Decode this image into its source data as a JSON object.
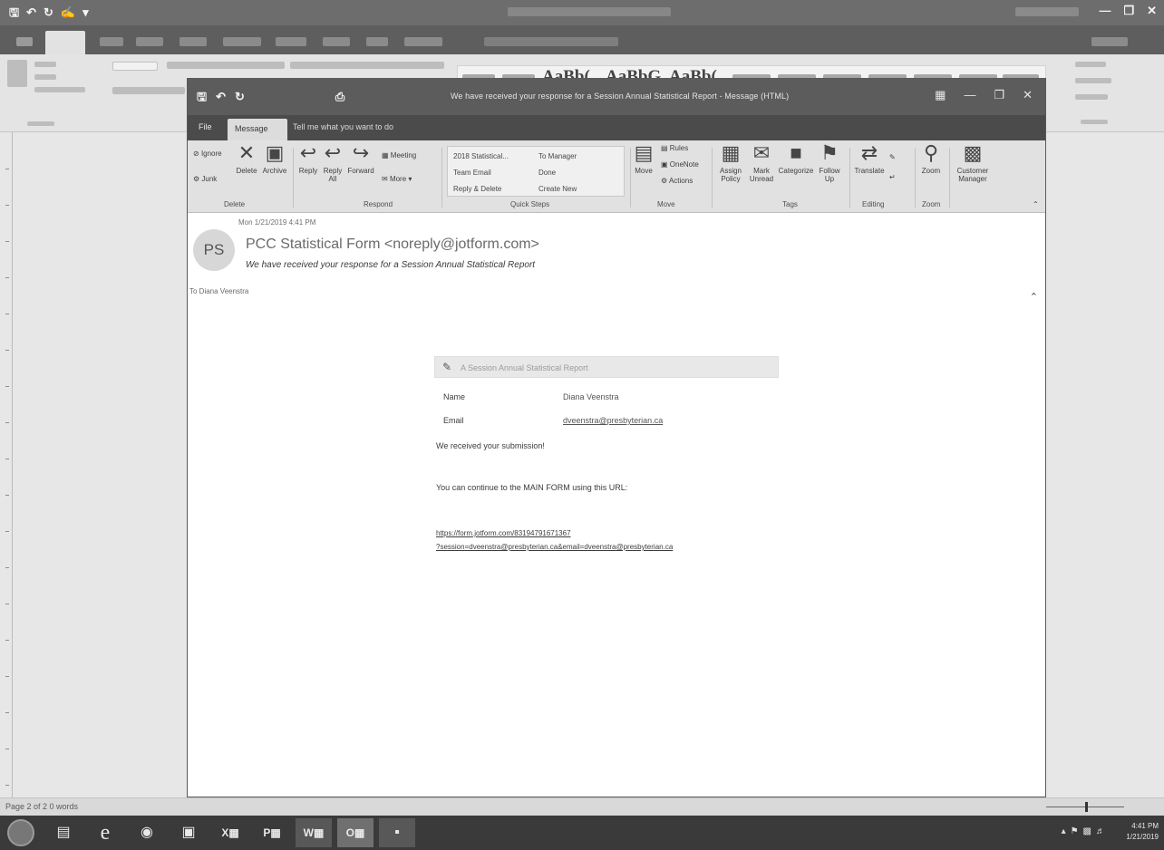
{
  "word": {
    "quick_access_icons": [
      "save-icon",
      "undo-icon",
      "redo-icon",
      "touch-mode-icon",
      "customize-icon"
    ],
    "ribbon_styles": [
      "AaBb(",
      "AaBbG",
      "AaBb("
    ],
    "status_text": "Page 2 of 2   0 words"
  },
  "outlook": {
    "window_title": "We have received your response for a Session Annual Statistical Report  -  Message (HTML)",
    "tabs": {
      "file": "File",
      "message": "Message",
      "tell_me": "Tell me what you want to do"
    },
    "ribbon": {
      "delete_group": {
        "ignore": "Ignore",
        "junk": "Junk",
        "delete": "Delete",
        "archive": "Archive",
        "label": "Delete"
      },
      "respond_group": {
        "reply": "Reply",
        "reply_all": "Reply All",
        "forward": "Forward",
        "meeting": "Meeting",
        "more": "More",
        "label": "Respond"
      },
      "quick_steps": {
        "items": [
          "2018 Statistical...",
          "To Manager",
          "Team Email",
          "Done",
          "Reply & Delete",
          "Create New"
        ],
        "label": "Quick Steps"
      },
      "move_group": {
        "move": "Move",
        "rules": "Rules",
        "onenote": "OneNote",
        "actions": "Actions",
        "label": "Move"
      },
      "tags_group": {
        "assign_policy": "Assign Policy",
        "mark_unread": "Mark Unread",
        "categorize": "Categorize",
        "follow_up": "Follow Up",
        "label": "Tags"
      },
      "editing_group": {
        "translate": "Translate",
        "label": "Editing"
      },
      "zoom_group": {
        "zoom": "Zoom",
        "label": "Zoom"
      },
      "customer_group": {
        "customer_manager": "Customer Manager"
      }
    },
    "header": {
      "date": "Mon 1/21/2019 4:41 PM",
      "avatar_initials": "PS",
      "from": "PCC Statistical Form <noreply@jotform.com>",
      "subject": "We have received your response for a Session Annual Statistical Report",
      "to": "To   Diana Veenstra"
    },
    "body": {
      "form_title": "A Session Annual Statistical Report",
      "rows": [
        {
          "label": "Name",
          "value": "Diana Veenstra"
        },
        {
          "label": "Email",
          "value": "dveenstra@presbyterian.ca"
        }
      ],
      "received": "We received your submission!",
      "continue_text": "You can continue to the MAIN FORM using this URL:",
      "url_line1": "https://form.jotform.com/83194791671367",
      "url_line2": "?session=dveenstra@presbyterian.ca&email=dveenstra@presbyterian.ca"
    }
  },
  "taskbar": {
    "items": [
      "start-icon",
      "explorer-icon",
      "ie-icon",
      "chrome-icon",
      "app-icon",
      "excel-icon",
      "project-icon",
      "word-icon",
      "outlook-icon",
      "app2-icon"
    ],
    "time": "4:41 PM",
    "date": "1/21/2019"
  }
}
